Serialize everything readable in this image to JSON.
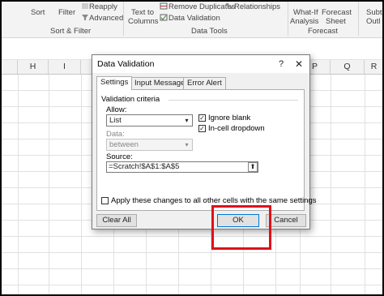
{
  "ribbon": {
    "sort": "Sort",
    "filter": "Filter",
    "reapply": "Reapply",
    "advanced": "Advanced",
    "text_to_columns_1": "Text to",
    "text_to_columns_2": "Columns",
    "remove_duplicates": "Remove Duplicates",
    "data_validation": "Data Validation",
    "relationships": "Relationships",
    "whatif_1": "What-If",
    "whatif_2": "Analysis",
    "forecast_sheet_1": "Forecast",
    "forecast_sheet_2": "Sheet",
    "subtotal_1": "Subto",
    "subtotal_2": "Outl",
    "group_sort_filter": "Sort & Filter",
    "group_data_tools": "Data Tools",
    "group_forecast": "Forecast"
  },
  "columns": [
    "H",
    "I",
    "",
    "",
    "",
    "",
    "",
    "P",
    "Q",
    "R"
  ],
  "dialog": {
    "title": "Data Validation",
    "help": "?",
    "close": "✕",
    "tabs": [
      "Settings",
      "Input Message",
      "Error Alert"
    ],
    "criteria_title": "Validation criteria",
    "allow_label": "Allow:",
    "allow_value": "List",
    "ignore_blank": "Ignore blank",
    "in_cell_dropdown": "In-cell dropdown",
    "data_label": "Data:",
    "data_value": "between",
    "source_label": "Source:",
    "source_value": "=Scratch!$A$1:$A$5",
    "apply_all": "Apply these changes to all other cells with the same settings",
    "clear_all": "Clear All",
    "ok": "OK",
    "cancel": "Cancel"
  },
  "colors": {
    "highlight": "#e0101a",
    "default_button_border": "#0078d7"
  }
}
